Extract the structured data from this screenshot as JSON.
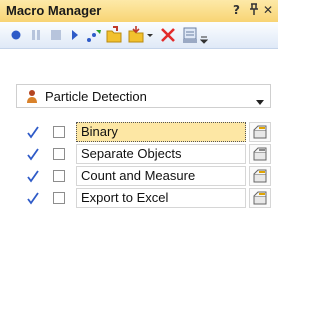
{
  "window": {
    "title": "Macro Manager",
    "help_glyph": "?",
    "pin_glyph": "↕",
    "close_glyph": "✕"
  },
  "toolbar": {
    "icons": [
      "record-icon",
      "pause-icon",
      "stop-icon",
      "play-icon",
      "step-run-icon",
      "load-macro-icon",
      "save-macro-icon",
      "delete-icon",
      "macro-options-icon"
    ]
  },
  "macro_selector": {
    "icon": "person-icon",
    "selected": "Particle Detection"
  },
  "steps": [
    {
      "label": "Binary",
      "checked": true,
      "selected": true
    },
    {
      "label": "Separate Objects",
      "checked": true,
      "selected": false
    },
    {
      "label": "Count and Measure",
      "checked": true,
      "selected": false
    },
    {
      "label": "Export to Excel",
      "checked": true,
      "selected": false
    }
  ],
  "colors": {
    "title_bar": "#f8d474",
    "selected_row": "#fde7a4",
    "check": "#2f5bc8",
    "delete": "#e22b2b"
  }
}
